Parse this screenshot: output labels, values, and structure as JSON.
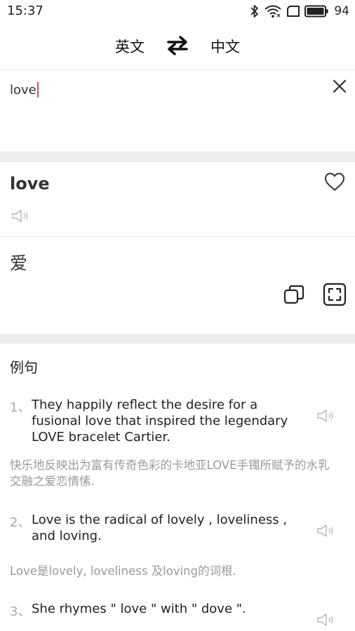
{
  "status_bar": {
    "time": "15:37",
    "battery": "94"
  },
  "lang_bar": {
    "source": "英文",
    "target": "中文",
    "swap_icon": "swap-arrows-icon"
  },
  "input": {
    "value": "love"
  },
  "result": {
    "word": "love",
    "translation": "爱"
  },
  "examples": {
    "title": "例句",
    "items": [
      {
        "num": "1、",
        "en": "They happily reflect the desire for a fusional love that inspired the legendary LOVE bracelet Cartier.",
        "zh": "快乐地反映出为富有传奇色彩的卡地亚LOVE手镯所赋予的水乳交融之爱恋情愫."
      },
      {
        "num": "2、",
        "en": "Love is the radical of lovely , loveliness , and loving.",
        "zh": "Love是lovely, loveliness 及loving的词根."
      },
      {
        "num": "3、",
        "en": "She rhymes \" love \" with \" dove \".",
        "zh": ""
      }
    ]
  },
  "colors": {
    "caret": "#e0447a",
    "band": "#ededed",
    "muted_text": "#9a9a9a"
  }
}
